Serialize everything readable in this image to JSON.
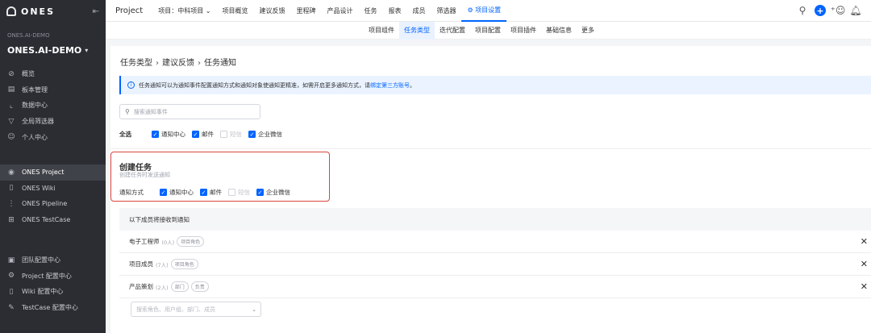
{
  "app": {
    "logo_text": "ONES",
    "org_label": "ONES.AI-DEMO",
    "org_name": "ONES.AI-DEMO"
  },
  "sidebar": {
    "items": [
      {
        "label": "概览",
        "icon": "compass-icon"
      },
      {
        "label": "板本管理",
        "icon": "board-icon"
      },
      {
        "label": "数据中心",
        "icon": "chart-icon"
      },
      {
        "label": "全局筛选器",
        "icon": "filter-icon"
      },
      {
        "label": "个人中心",
        "icon": "user-icon"
      }
    ],
    "products": [
      {
        "label": "ONES Project",
        "icon": "project-icon",
        "active": true
      },
      {
        "label": "ONES Wiki",
        "icon": "wiki-icon"
      },
      {
        "label": "ONES Pipeline",
        "icon": "pipeline-icon"
      },
      {
        "label": "ONES TestCase",
        "icon": "testcase-icon"
      }
    ],
    "config": [
      {
        "label": "团队配置中心",
        "icon": "team-config-icon"
      },
      {
        "label": "Project 配置中心",
        "icon": "project-config-icon"
      },
      {
        "label": "Wiki 配置中心",
        "icon": "wiki-config-icon"
      },
      {
        "label": "TestCase 配置中心",
        "icon": "testcase-config-icon"
      }
    ]
  },
  "topbar": {
    "project_label": "Project",
    "project_select": "项目：中科项目",
    "tabs": [
      "项目概览",
      "建议反馈",
      "里程碑",
      "产品设计",
      "任务",
      "报表",
      "成员",
      "筛选器",
      "项目设置"
    ],
    "active_tab": "项目设置"
  },
  "subtabs": {
    "items": [
      "项目组件",
      "任务类型",
      "迭代配置",
      "项目配置",
      "项目插件",
      "基础信息",
      "更多"
    ],
    "active": "任务类型"
  },
  "breadcrumb": {
    "a": "任务类型",
    "b": "建议反馈",
    "c": "任务通知"
  },
  "info": {
    "text": "任务通知可以为通知事件配置通知方式和通知对象使通知更精准，如需开启更多通知方式，请",
    "link": "绑定第三方账号",
    "end": "。"
  },
  "search": {
    "placeholder": "搜索通知事件"
  },
  "select_all": {
    "label": "全选",
    "options": [
      {
        "label": "通知中心",
        "checked": true
      },
      {
        "label": "邮件",
        "checked": true
      },
      {
        "label": "短信",
        "checked": false,
        "disabled": true
      },
      {
        "label": "企业微信",
        "checked": true
      }
    ]
  },
  "event": {
    "title": "创建任务",
    "subtitle": "创建任务时发送通知",
    "method_label": "通知方式",
    "options": [
      {
        "label": "通知中心",
        "checked": true
      },
      {
        "label": "邮件",
        "checked": true
      },
      {
        "label": "短信",
        "checked": false,
        "disabled": true
      },
      {
        "label": "企业微信",
        "checked": true
      }
    ]
  },
  "receivers": {
    "header": "以下成员将接收到通知",
    "members": [
      {
        "name": "电子工程师",
        "count": "(0人)",
        "tags": [
          "项目角色"
        ]
      },
      {
        "name": "项目成员",
        "count": "(7人)",
        "tags": [
          "项目角色"
        ]
      },
      {
        "name": "产品策划",
        "count": "(2人)",
        "tags": [
          "部门",
          "负责"
        ]
      }
    ],
    "add_placeholder": "搜索角色、用户组、部门、成员"
  }
}
